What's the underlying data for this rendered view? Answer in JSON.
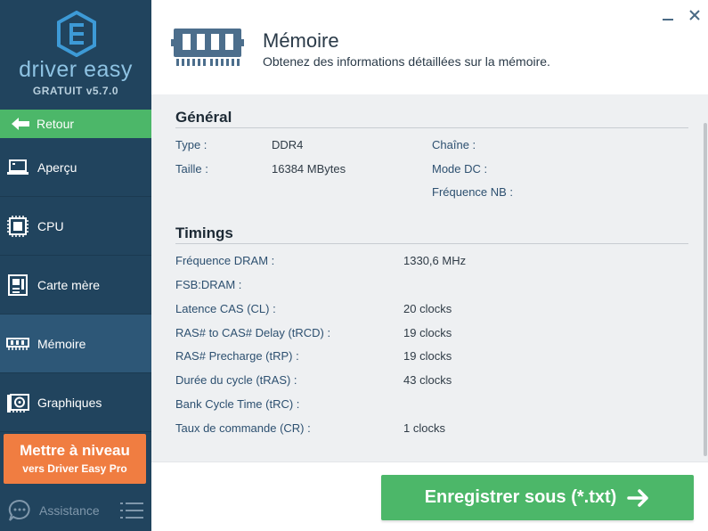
{
  "app": {
    "brand": "driver easy",
    "version": "GRATUIT v5.7.0"
  },
  "sidebar": {
    "back_label": "Retour",
    "items": [
      {
        "label": "Aperçu",
        "icon": "laptop-icon"
      },
      {
        "label": "CPU",
        "icon": "cpu-icon"
      },
      {
        "label": "Carte mère",
        "icon": "motherboard-icon"
      },
      {
        "label": "Mémoire",
        "icon": "ram-icon",
        "active": true
      },
      {
        "label": "Graphiques",
        "icon": "graphics-card-icon"
      }
    ],
    "upgrade_title": "Mettre à niveau",
    "upgrade_sub": "vers Driver Easy Pro",
    "assist_label": "Assistance"
  },
  "header": {
    "title": "Mémoire",
    "subtitle": "Obtenez des informations détaillées sur la mémoire."
  },
  "general": {
    "title": "Général",
    "type_label": "Type :",
    "type_value": "DDR4",
    "size_label": "Taille :",
    "size_value": "16384 MBytes",
    "channel_label": "Chaîne :",
    "dc_mode_label": "Mode DC :",
    "nb_freq_label": "Fréquence NB :"
  },
  "timings": {
    "title": "Timings",
    "rows": [
      {
        "label": "Fréquence DRAM :",
        "value": "1330,6 MHz"
      },
      {
        "label": "FSB:DRAM :",
        "value": ""
      },
      {
        "label": "Latence CAS (CL) :",
        "value": "20 clocks"
      },
      {
        "label": "RAS# to CAS# Delay (tRCD) :",
        "value": "19 clocks"
      },
      {
        "label": "RAS# Precharge (tRP) :",
        "value": "19 clocks"
      },
      {
        "label": "Durée du cycle (tRAS) :",
        "value": "43 clocks"
      },
      {
        "label": "Bank Cycle Time (tRC) :",
        "value": ""
      },
      {
        "label": "Taux de commande (CR) :",
        "value": "1 clocks"
      }
    ]
  },
  "footer": {
    "save_label": "Enregistrer sous (*.txt)"
  },
  "colors": {
    "sidebar_bg": "#21445e",
    "accent_green": "#4cb769",
    "upgrade_orange": "#f07d41"
  }
}
